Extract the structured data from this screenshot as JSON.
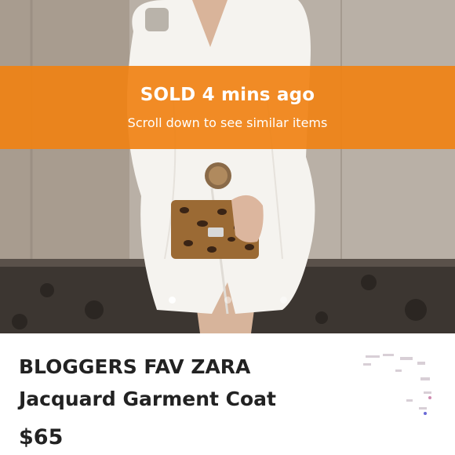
{
  "banner": {
    "title": "SOLD 4 mins ago",
    "subtitle": "Scroll down to see similar items"
  },
  "carousel": {
    "count": 3,
    "active": 1
  },
  "listing": {
    "title_line1": "BLOGGERS FAV ZARA",
    "title_line2": "Jacquard Garment Coat",
    "price": "$65"
  },
  "colors": {
    "banner": "#F08214",
    "text": "#222222"
  }
}
